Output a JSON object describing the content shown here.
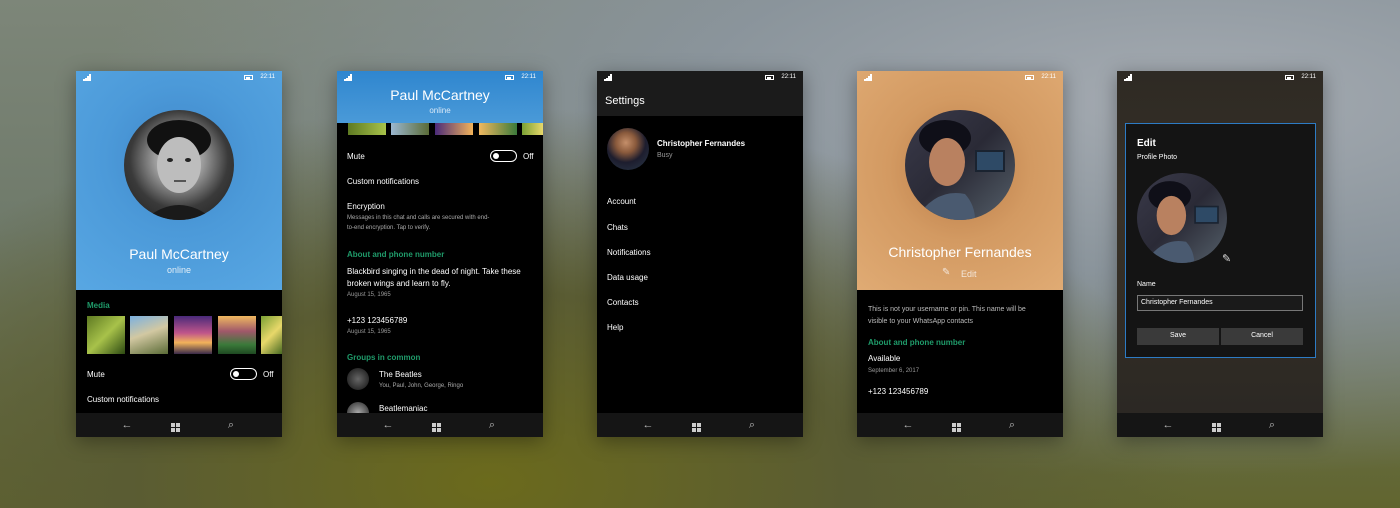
{
  "status": {
    "time": "22:11"
  },
  "screen1": {
    "name": "Paul McCartney",
    "presence": "online",
    "media_label": "Media",
    "mute_label": "Mute",
    "mute_state": "Off",
    "custom_notifications": "Custom notifications"
  },
  "screen2": {
    "name": "Paul McCartney",
    "presence": "online",
    "mute_label": "Mute",
    "mute_state": "Off",
    "custom_notifications": "Custom notifications",
    "encryption_title": "Encryption",
    "encryption_desc1": "Messages in this chat and calls are secured with end-",
    "encryption_desc2": "to-end encryption. Tap to verify.",
    "about_header": "About and phone number",
    "about_line1": "Blackbird singing in the dead of night. Take these",
    "about_line2": "broken wings and learn to fly.",
    "about_date": "August 15, 1965",
    "phone": "+123 123456789",
    "phone_date": "August 15, 1965",
    "groups_header": "Groups in common",
    "groups": [
      {
        "name": "The Beatles",
        "members": "You, Paul, John, George, Ringo"
      },
      {
        "name": "Beatlemaniac",
        "members": ""
      }
    ]
  },
  "screen3": {
    "title": "Settings",
    "profile_name": "Christopher Fernandes",
    "profile_status": "Busy",
    "menu": [
      "Account",
      "Chats",
      "Notifications",
      "Data usage",
      "Contacts",
      "Help"
    ]
  },
  "screen4": {
    "name": "Christopher Fernandes",
    "edit_label": "Edit",
    "notice1": "This is not your username or pin. This name will be",
    "notice2": "visible to your WhatsApp contacts",
    "about_header": "About and phone number",
    "about_value": "Available",
    "about_date": "September 6, 2017",
    "phone": "+123 123456789"
  },
  "screen5": {
    "dialog_title": "Edit",
    "photo_label": "Profile Photo",
    "name_label": "Name",
    "name_value": "Christopher Fernandes",
    "save": "Save",
    "cancel": "Cancel"
  },
  "icons": {
    "back": "back-arrow-icon",
    "start": "windows-start-icon",
    "search": "search-icon",
    "pencil": "pencil-icon"
  },
  "colors": {
    "accent": "#1f9b6a",
    "screen1_header": "#4a9ad8",
    "screen2_header": "#3a8fd4",
    "screen4_header": "#d7995f",
    "dialog_border": "#2d7bc4"
  }
}
